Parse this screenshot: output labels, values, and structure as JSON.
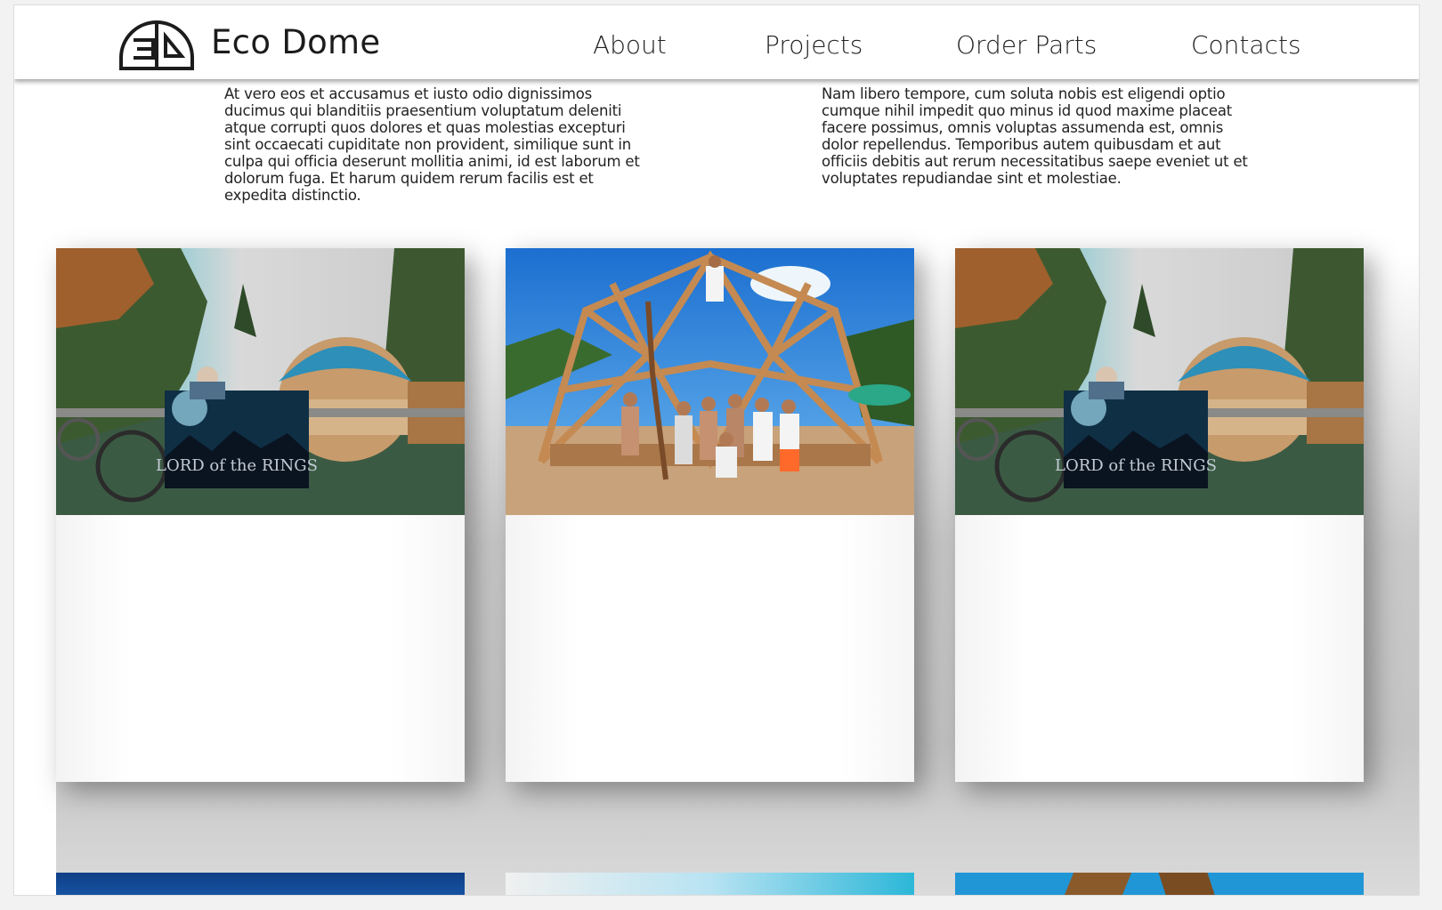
{
  "header": {
    "brand": "Eco Dome",
    "nav": {
      "about": "About",
      "projects": "Projects",
      "order_parts": "Order Parts",
      "contacts": "Contacts"
    }
  },
  "intro": {
    "left_text": "At vero eos et accusamus et iusto odio dignissimos ducimus qui blanditiis praesentium voluptatum deleniti atque corrupti quos dolores et quas molestias excepturi sint occaecati cupiditate non provident, similique sunt in culpa qui officia deserunt mollitia animi, id est laborum et dolorum fuga. Et harum quidem rerum facilis est et expedita distinctio.",
    "right_text": "Nam libero tempore, cum soluta nobis est eligendi optio cumque nihil impedit quo minus id quod maxime placeat facere possimus, omnis voluptas assumenda est, omnis dolor repellendus. Temporibus autem quibusdam et aut officiis debitis aut rerum necessitatibus saepe eveniet ut et voluptates repudiandae sint et molestiae."
  },
  "gallery": {
    "cards": [
      {
        "image": "dome-festival-photo",
        "sign_text": "LORD of the RINGS"
      },
      {
        "image": "dome-construction-team-photo"
      },
      {
        "image": "dome-festival-photo",
        "sign_text": "LORD of the RINGS"
      }
    ]
  },
  "icons": {
    "logo": "eco-dome-logo-icon",
    "scroll_up": "arrow-up-icon",
    "scroll_down": "arrow-down-icon"
  },
  "colors": {
    "text": "#222222",
    "header_bg": "#ffffff",
    "gallery_bg": "#c4c4c4"
  }
}
